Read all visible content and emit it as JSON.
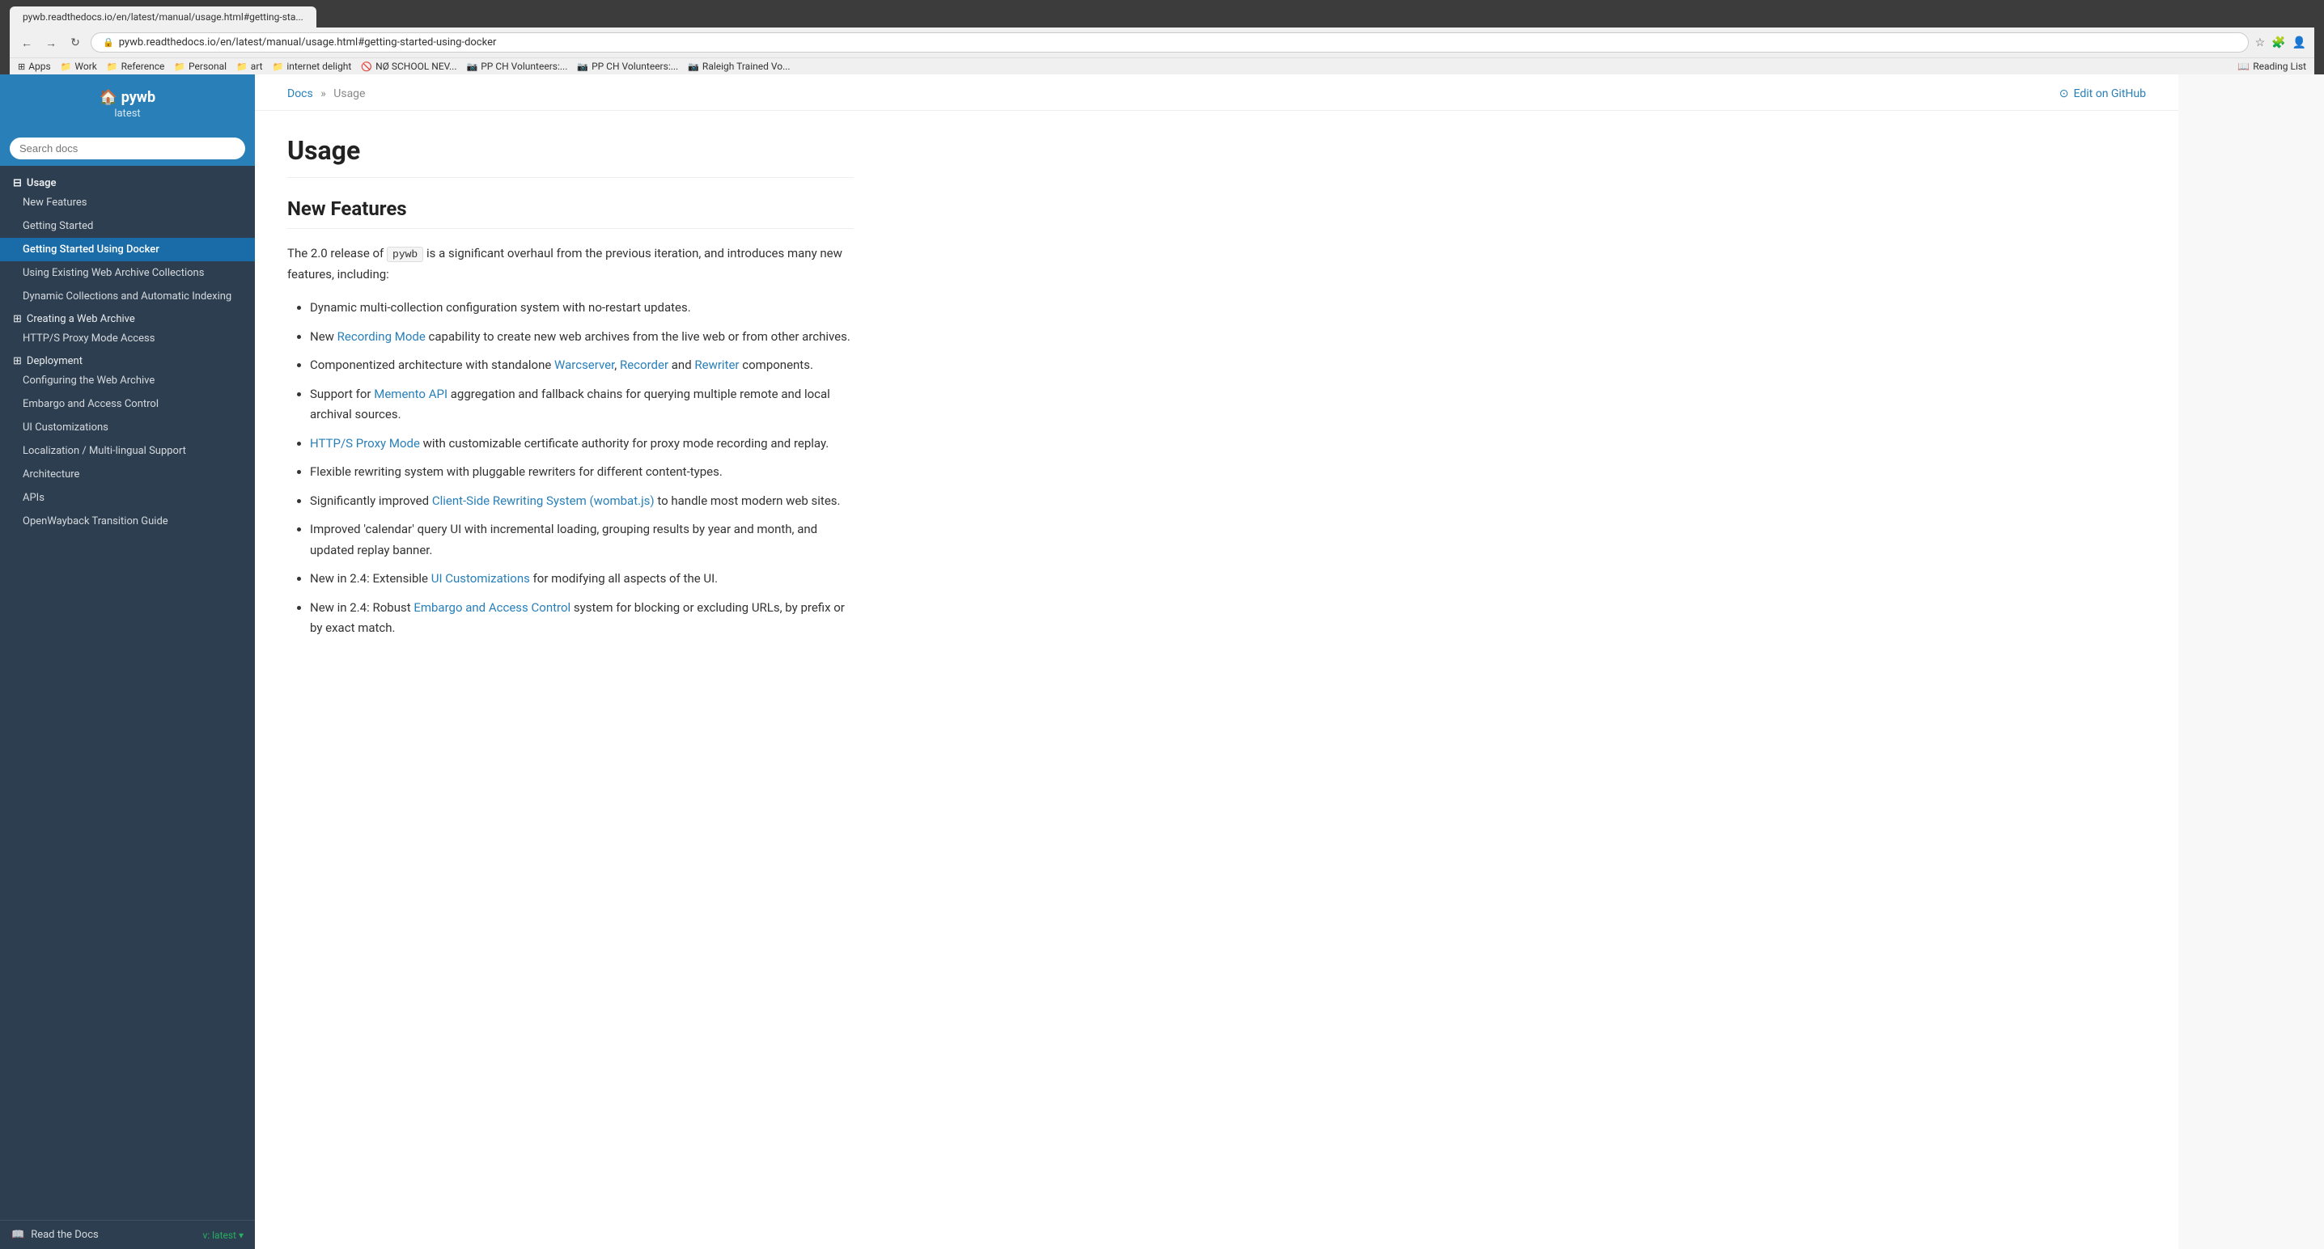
{
  "browser": {
    "url": "pywb.readthedocs.io/en/latest/manual/usage.html#getting-started-using-docker",
    "tab_label": "pywb.readthedocs.io/en/latest/manual/usage.html#getting-sta...",
    "bookmarks": [
      {
        "icon": "⊞",
        "label": "Apps"
      },
      {
        "icon": "📁",
        "label": "Work"
      },
      {
        "icon": "📁",
        "label": "Reference"
      },
      {
        "icon": "📁",
        "label": "Personal"
      },
      {
        "icon": "📁",
        "label": "art"
      },
      {
        "icon": "📁",
        "label": "internet delight"
      },
      {
        "icon": "🚫",
        "label": "NØ SCHOOL NEV..."
      },
      {
        "icon": "📷",
        "label": "PP CH Volunteers:..."
      },
      {
        "icon": "📷",
        "label": "PP CH Volunteers:..."
      },
      {
        "icon": "📷",
        "label": "Raleigh Trained Vo..."
      }
    ]
  },
  "sidebar": {
    "brand_title": "🏠 pywb",
    "brand_subtitle": "latest",
    "search_placeholder": "Search docs",
    "nav": {
      "usage_label": "Usage",
      "items": [
        {
          "label": "New Features",
          "active": false
        },
        {
          "label": "Getting Started",
          "active": false
        },
        {
          "label": "Getting Started Using Docker",
          "active": true
        },
        {
          "label": "Using Existing Web Archive Collections",
          "active": false
        },
        {
          "label": "Dynamic Collections and Automatic Indexing",
          "active": false
        },
        {
          "label": "Creating a Web Archive",
          "active": false
        },
        {
          "label": "HTTP/S Proxy Mode Access",
          "active": false
        },
        {
          "label": "Deployment",
          "active": false
        },
        {
          "label": "Configuring the Web Archive",
          "active": false
        },
        {
          "label": "Embargo and Access Control",
          "active": false
        },
        {
          "label": "UI Customizations",
          "active": false
        },
        {
          "label": "Localization / Multi-lingual Support",
          "active": false
        },
        {
          "label": "Architecture",
          "active": false
        },
        {
          "label": "APIs",
          "active": false
        },
        {
          "label": "OpenWayback Transition Guide",
          "active": false
        }
      ]
    },
    "footer_label": "Read the Docs",
    "footer_version": "v: latest ▾"
  },
  "breadcrumb": {
    "docs_label": "Docs",
    "sep": "»",
    "current": "Usage"
  },
  "edit_github": {
    "label": "Edit on GitHub",
    "icon": "⊙"
  },
  "content": {
    "page_title": "Usage",
    "section_title": "New Features",
    "intro": {
      "prefix": "The 2.0 release of",
      "code": "pywb",
      "suffix": "is a significant overhaul from the previous iteration, and introduces many new features, including:"
    },
    "features": [
      {
        "text": "Dynamic multi-collection configuration system with no-restart updates.",
        "link": null,
        "link_text": null
      },
      {
        "text_before": "New",
        "link": "Recording Mode",
        "text_after": "capability to create new web archives from the live web or from other archives."
      },
      {
        "text_before": "Componentized architecture with standalone",
        "links": [
          "Warcserver",
          "Recorder",
          "Rewriter"
        ],
        "text_after": "components."
      },
      {
        "text_before": "Support for",
        "link": "Memento API",
        "text_after": "aggregation and fallback chains for querying multiple remote and local archival sources."
      },
      {
        "text_before": "",
        "link": "HTTP/S Proxy Mode",
        "text_after": "with customizable certificate authority for proxy mode recording and replay."
      },
      {
        "text": "Flexible rewriting system with pluggable rewriters for different content-types.",
        "link": null
      },
      {
        "text_before": "Significantly improved",
        "link": "Client-Side Rewriting System (wombat.js)",
        "text_after": "to handle most modern web sites."
      },
      {
        "text": "Improved 'calendar' query UI with incremental loading, grouping results by year and month, and updated replay banner.",
        "link": null
      },
      {
        "text_before": "New in 2.4: Extensible",
        "link": "UI Customizations",
        "text_after": "for modifying all aspects of the UI."
      },
      {
        "text_before": "New in 2.4: Robust",
        "link": "Embargo and Access Control",
        "text_after": "system for blocking or excluding URLs, by prefix or by exact match."
      }
    ]
  }
}
